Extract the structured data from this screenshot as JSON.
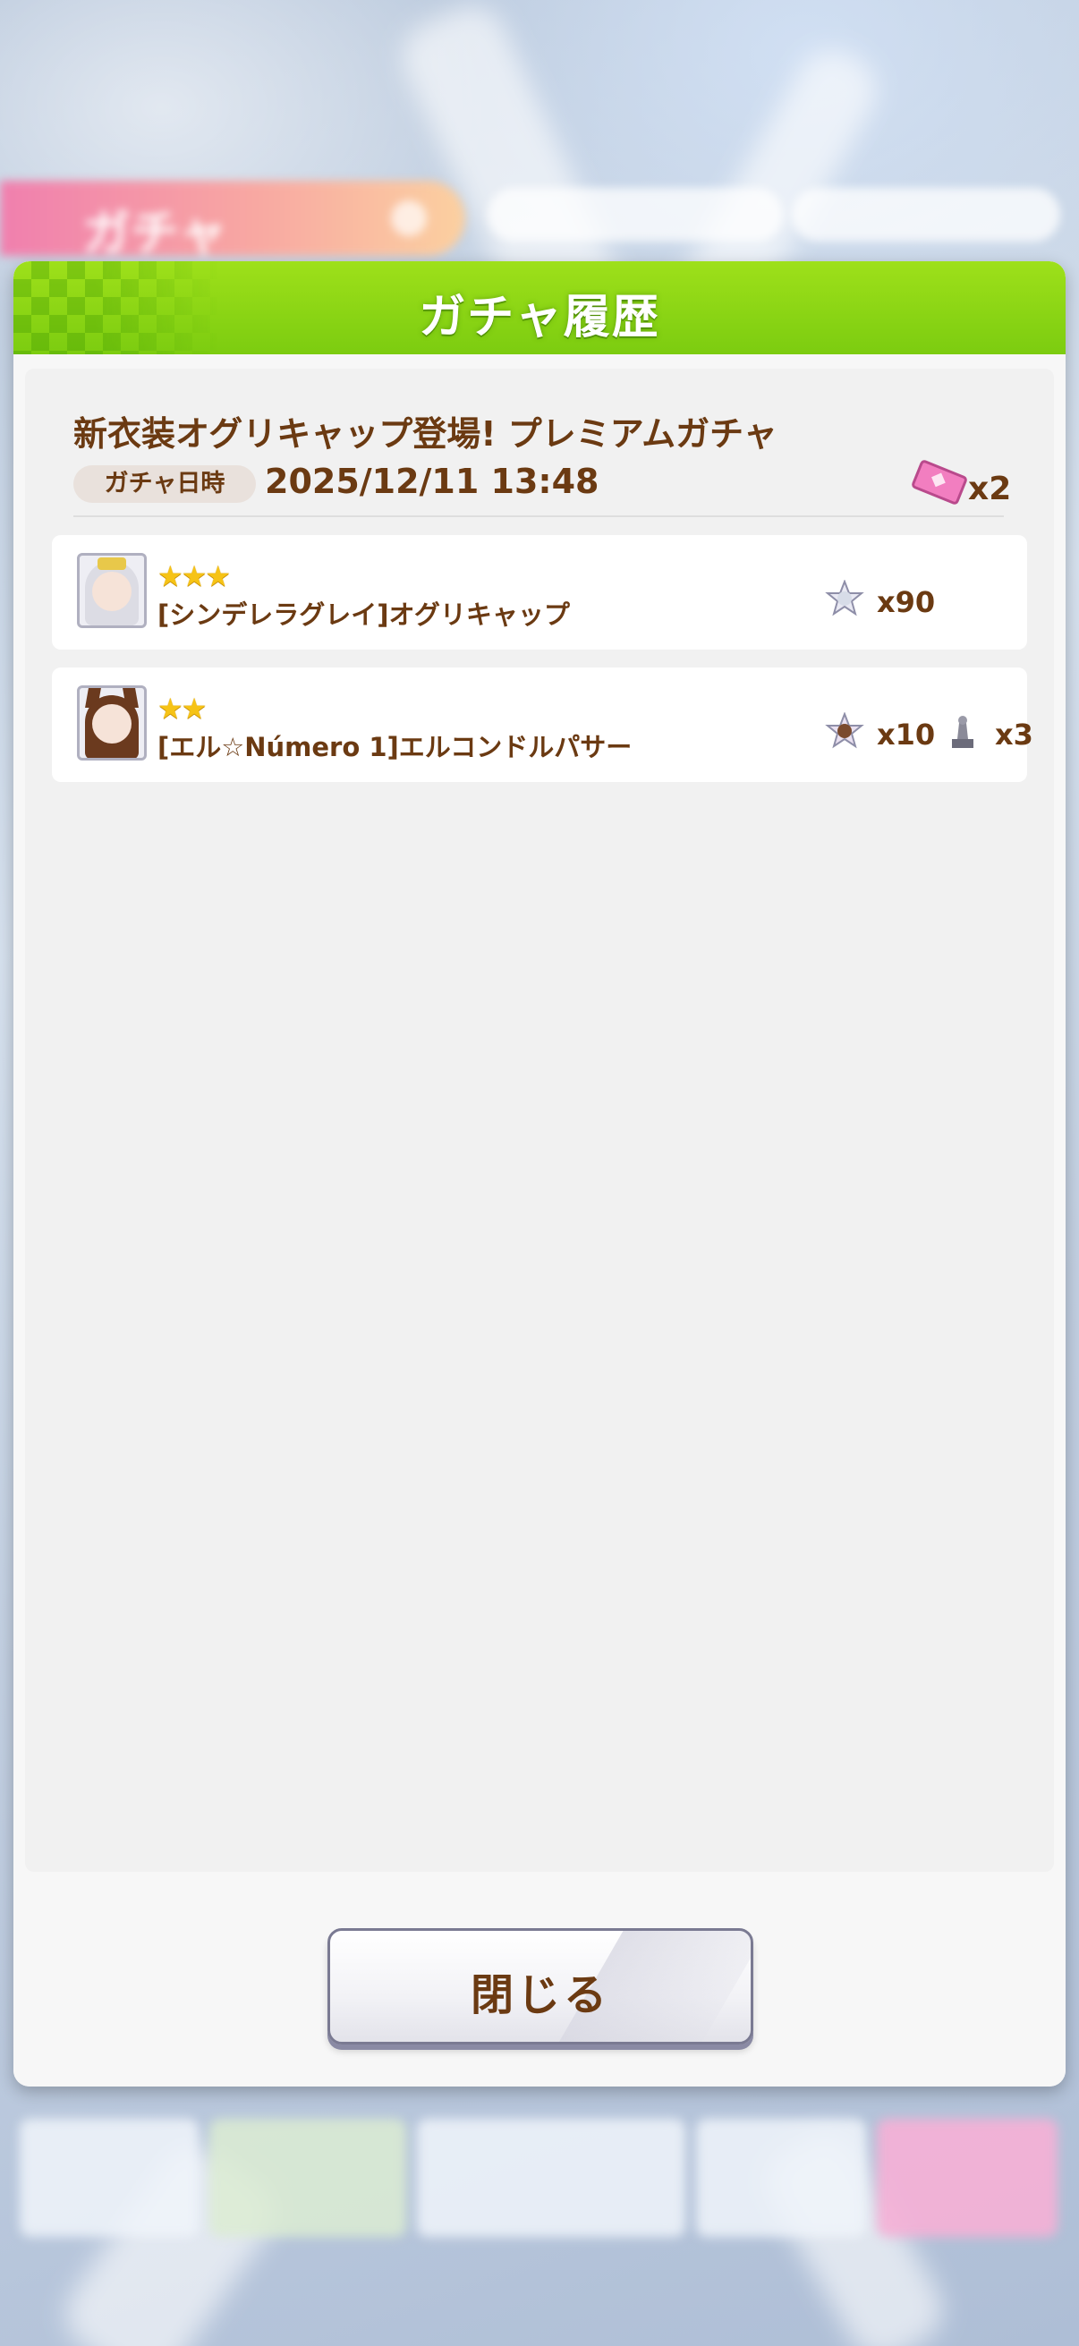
{
  "background": {
    "screen_title": "ガチャ"
  },
  "dialog": {
    "title": "ガチャ履歴",
    "banner_name": "新衣装オグリキャップ登場! プレミアムガチャ",
    "date_label": "ガチャ日時",
    "date_value": "2025/12/11 13:48",
    "ticket_amount": "x2",
    "results": [
      {
        "stars": "★★★",
        "rarity": 3,
        "name": "[シンデレラグレイ]オグリキャップ",
        "items": [
          {
            "icon": "memorial-piece-icon",
            "amount": "x90"
          }
        ]
      },
      {
        "stars": "★★",
        "rarity": 2,
        "name": "[エル☆Número 1]エルコンドルパサー",
        "items": [
          {
            "icon": "memorial-piece-icon",
            "amount": "x10"
          },
          {
            "icon": "goddess-statue-icon",
            "amount": "x3"
          }
        ]
      }
    ],
    "close_label": "閉じる"
  },
  "colors": {
    "header_green": "#8ed614",
    "text_brown": "#6b3a12",
    "star_gold": "#f6c316",
    "ticket_pink": "#f27ec0"
  }
}
